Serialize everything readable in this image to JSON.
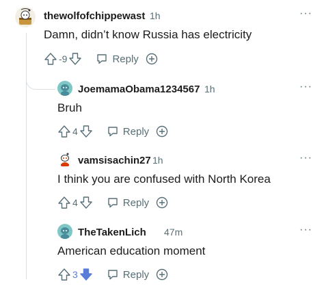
{
  "comments": [
    {
      "user": "thewolfofchippewast",
      "time": "1h",
      "text": "Damn, didn’t know Russia has electricity",
      "votes": "-9",
      "reply_label": "Reply",
      "vote_state": "none",
      "avatar": "snoo-avatar-scroll"
    },
    {
      "user": "JoemamaObama1234567",
      "time": "1h",
      "text": "Bruh",
      "votes": "4",
      "reply_label": "Reply",
      "vote_state": "none",
      "avatar": "snoo-avatar-teal"
    },
    {
      "user": "vamsisachin27",
      "time": "1h",
      "text": "I think you are confused with North Korea",
      "votes": "4",
      "reply_label": "Reply",
      "vote_state": "none",
      "avatar": "snoo-avatar-red"
    },
    {
      "user": "TheTakenLich",
      "time": "47m",
      "text": "American education moment",
      "votes": "3",
      "reply_label": "Reply",
      "vote_state": "downvoted",
      "avatar": "snoo-avatar-teal"
    }
  ],
  "colors": {
    "downvote_active": "#5a7dd6",
    "upvote_active_count": "#5a7dd6",
    "meta": "#576f76",
    "thread_line": "#d9dfe2"
  }
}
